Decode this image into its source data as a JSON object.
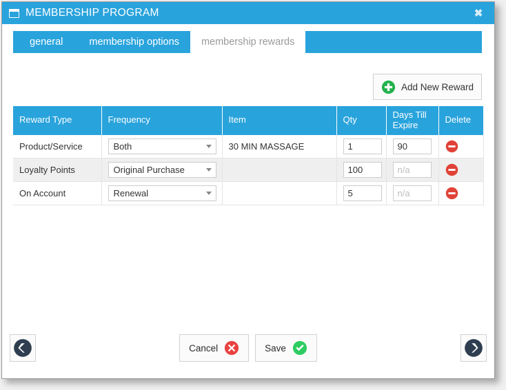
{
  "window": {
    "title": "MEMBERSHIP PROGRAM",
    "title_icon": "window-icon",
    "close_label": "✖",
    "accent_color": "#29a3dc",
    "header_text_color": "#ffffff"
  },
  "tabs": [
    {
      "label": "general",
      "active": false
    },
    {
      "label": "membership options",
      "active": false
    },
    {
      "label": "membership rewards",
      "active": true
    }
  ],
  "toolbar": {
    "add_reward_label": "Add New Reward",
    "add_reward_icon": "plus-circle-icon",
    "add_reward_icon_color": "#22b24c"
  },
  "table": {
    "columns": [
      {
        "key": "reward_type",
        "label": "Reward Type"
      },
      {
        "key": "frequency",
        "label": "Frequency"
      },
      {
        "key": "item",
        "label": "Item"
      },
      {
        "key": "qty",
        "label": "Qty"
      },
      {
        "key": "days_till_expire",
        "label": "Days Till Expire"
      },
      {
        "key": "delete",
        "label": "Delete"
      }
    ],
    "rows": [
      {
        "reward_type": "Product/Service",
        "frequency": "Both",
        "item": "30 MIN MASSAGE",
        "qty": "1",
        "days_till_expire": "90",
        "days_disabled": false,
        "delete_icon": "delete-circle-icon"
      },
      {
        "reward_type": "Loyalty Points",
        "frequency": "Original Purchase",
        "item": "",
        "qty": "100",
        "days_till_expire": "n/a",
        "days_disabled": true,
        "delete_icon": "delete-circle-icon"
      },
      {
        "reward_type": "On Account",
        "frequency": "Renewal",
        "item": "",
        "qty": "5",
        "days_till_expire": "n/a",
        "days_disabled": true,
        "delete_icon": "delete-circle-icon"
      }
    ]
  },
  "footer": {
    "cancel_label": "Cancel",
    "cancel_icon": "cancel-x-icon",
    "cancel_icon_color": "#e8423f",
    "save_label": "Save",
    "save_icon": "check-circle-icon",
    "save_icon_color": "#2ecc63",
    "prev_icon": "chevron-left-circle-icon",
    "next_icon": "chevron-right-circle-icon",
    "nav_icon_color": "#2e3e50"
  }
}
